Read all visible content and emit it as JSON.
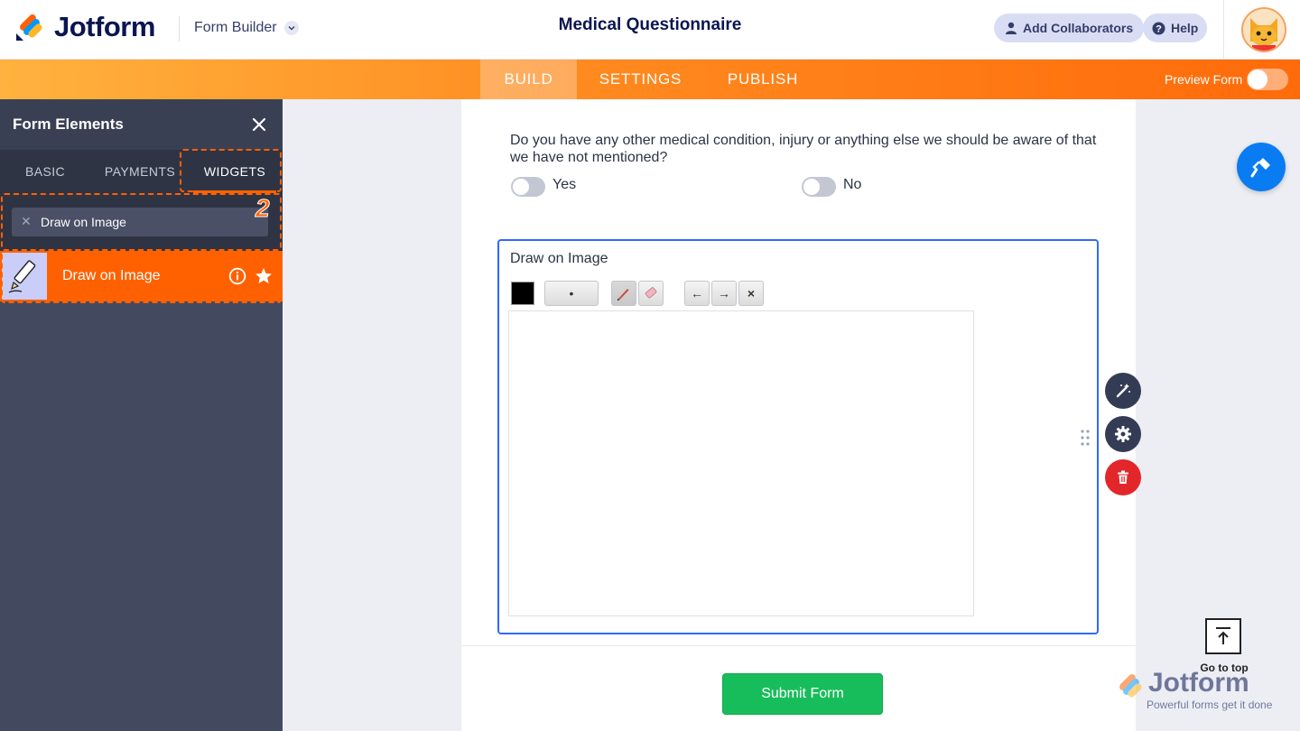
{
  "header": {
    "brand": "Jotform",
    "builder_menu": "Form Builder",
    "form_title": "Medical Questionnaire",
    "add_collaborators": "Add Collaborators",
    "help": "Help"
  },
  "nav": {
    "tabs": [
      {
        "label": "BUILD",
        "active": true
      },
      {
        "label": "SETTINGS",
        "active": false
      },
      {
        "label": "PUBLISH",
        "active": false
      }
    ],
    "preview_label": "Preview Form",
    "preview_on": false
  },
  "sidebar": {
    "title": "Form Elements",
    "tabs": [
      {
        "label": "BASIC",
        "active": false
      },
      {
        "label": "PAYMENTS",
        "active": false
      },
      {
        "label": "WIDGETS",
        "active": true
      }
    ],
    "search_value": "Draw on Image",
    "result": {
      "label": "Draw on Image"
    },
    "step_number": "2"
  },
  "form": {
    "question": "Do you have any other medical condition, injury or anything else we should be aware of that we have not mentioned?",
    "options": [
      "Yes",
      "No"
    ],
    "draw_widget": {
      "title": "Draw on Image",
      "color": "#000000",
      "tools": {
        "brush_size": "•",
        "undo": "←",
        "redo": "→",
        "clear": "×"
      }
    },
    "submit_label": "Submit Form"
  },
  "go_top_label": "Go to top",
  "watermark": {
    "brand": "Jotform",
    "tagline": "Powerful forms get it done"
  },
  "colors": {
    "accent": "#ff6100",
    "brand_navy": "#0a1551",
    "selection_blue": "#2e69ff",
    "submit_green": "#18bd5b",
    "delete_red": "#e3262a"
  }
}
